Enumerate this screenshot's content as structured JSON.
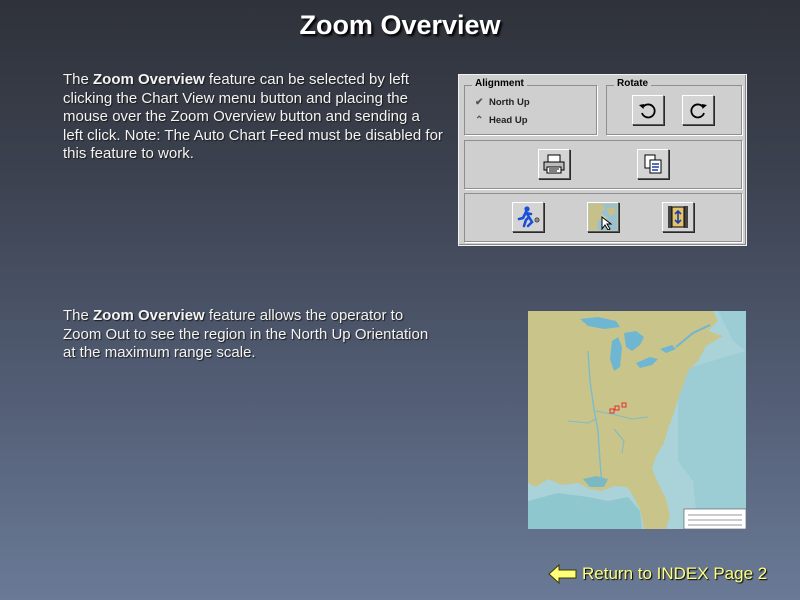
{
  "page": {
    "title": "Zoom Overview"
  },
  "para1": {
    "pre": "The ",
    "bold": "Zoom Overview",
    "post": " feature can be selected by left clicking the Chart View menu button and placing the mouse over the Zoom Overview button and sending a left click.   Note:  The Auto Chart Feed must be disabled for this feature to work."
  },
  "para2": {
    "pre": "The ",
    "bold": "Zoom Overview",
    "post": " feature allows the operator to Zoom Out to see the region in the North Up Orientation at the maximum range scale."
  },
  "panel": {
    "alignment_title": "Alignment",
    "north_up": "North Up",
    "head_up": "Head Up",
    "rotate_title": "Rotate"
  },
  "icons": {
    "rotate_left": "rotate-left-icon",
    "rotate_right": "rotate-right-icon",
    "print": "printer-icon",
    "copy": "copy-document-icon",
    "person": "running-person-icon",
    "zoom_overview": "zoom-overview-map-icon",
    "auto_chart_feed": "chart-feed-icon",
    "return": "left-arrow-icon"
  },
  "colors": {
    "return_text": "#ffff7a",
    "map_land": "#c9c489",
    "map_shallow": "#a9d3d8",
    "map_deep": "#8fc7cf",
    "target_marks": "#e23030"
  },
  "return_link": {
    "label": "Return to INDEX Page 2"
  }
}
